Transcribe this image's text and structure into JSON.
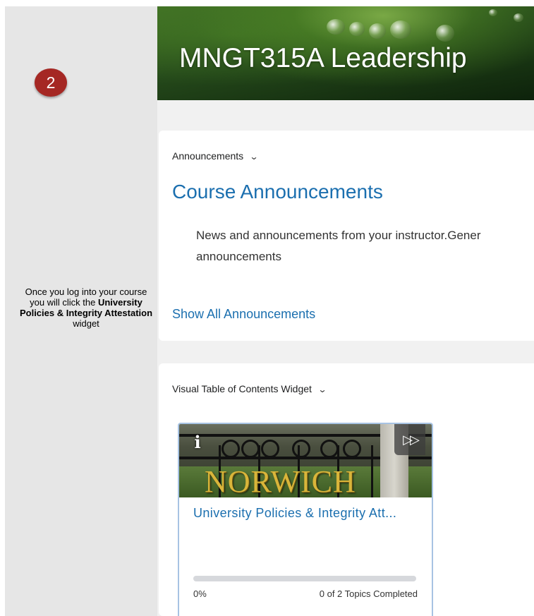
{
  "step_number": "2",
  "instruction": {
    "part1": "Once you log into your course you will click the ",
    "bold1": "University Policies & Integrity Attestation",
    "part2": " widget"
  },
  "course": {
    "title": "MNGT315A Leadership"
  },
  "announcements_widget": {
    "header": "Announcements",
    "title": "Course Announcements",
    "body_line1": "News and announcements from your instructor.Gener",
    "body_line2": "announcements",
    "show_all_link": "Show All Announcements"
  },
  "vtoc_widget": {
    "header": "Visual Table of Contents Widget",
    "tile": {
      "image_word": "NORWICH",
      "title": "University Policies & Integrity Att...",
      "progress_percent_label": "0%",
      "progress_fraction": 0,
      "topics_completed": "0 of 2 Topics Completed"
    }
  },
  "colors": {
    "link": "#1b6faf",
    "badge": "#a52824"
  },
  "icons": {
    "info": "info-icon",
    "fast_forward": "fast-forward-icon",
    "chevron": "chevron-down-icon"
  }
}
